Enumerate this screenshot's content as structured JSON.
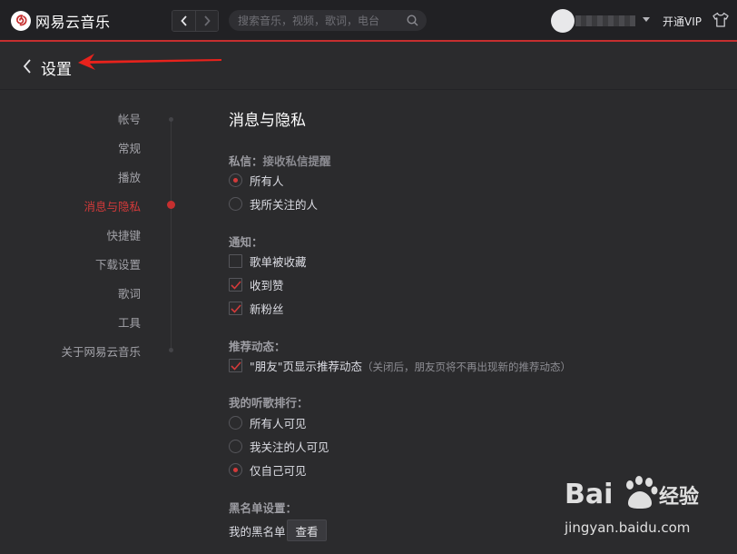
{
  "app": {
    "name": "网易云音乐"
  },
  "topbar": {
    "search_placeholder": "搜索音乐，视频，歌词，电台",
    "vip_label": "开通VIP"
  },
  "page": {
    "title": "设置"
  },
  "sidenav": {
    "items": [
      {
        "label": "帐号",
        "active": false
      },
      {
        "label": "常规",
        "active": false
      },
      {
        "label": "播放",
        "active": false
      },
      {
        "label": "消息与隐私",
        "active": true
      },
      {
        "label": "快捷键",
        "active": false
      },
      {
        "label": "下载设置",
        "active": false
      },
      {
        "label": "歌词",
        "active": false
      },
      {
        "label": "工具",
        "active": false
      },
      {
        "label": "关于网易云音乐",
        "active": false
      }
    ]
  },
  "section": {
    "title": "消息与隐私",
    "private_msg": {
      "label": "私信：",
      "sublabel": "接收私信提醒",
      "options": [
        {
          "label": "所有人",
          "selected": true
        },
        {
          "label": "我所关注的人",
          "selected": false
        }
      ]
    },
    "notify": {
      "label": "通知：",
      "options": [
        {
          "label": "歌单被收藏",
          "checked": false
        },
        {
          "label": "收到赞",
          "checked": true
        },
        {
          "label": "新粉丝",
          "checked": true
        }
      ]
    },
    "recommend": {
      "label": "推荐动态：",
      "option_label": "\"朋友\"页显示推荐动态",
      "option_hint": "（关闭后，朋友页将不再出现新的推荐动态）",
      "checked": true
    },
    "ranking": {
      "label": "我的听歌排行：",
      "options": [
        {
          "label": "所有人可见",
          "selected": false
        },
        {
          "label": "我关注的人可见",
          "selected": false
        },
        {
          "label": "仅自己可见",
          "selected": true
        }
      ]
    },
    "blacklist": {
      "label": "黑名单设置：",
      "text": "我的黑名单",
      "button": "查看"
    }
  },
  "watermark": {
    "brand": "Bai du 经验",
    "url": "jingyan.baidu.com"
  },
  "colors": {
    "accent": "#c62f2f",
    "bg": "#2b2b2d",
    "topbar": "#212124"
  }
}
